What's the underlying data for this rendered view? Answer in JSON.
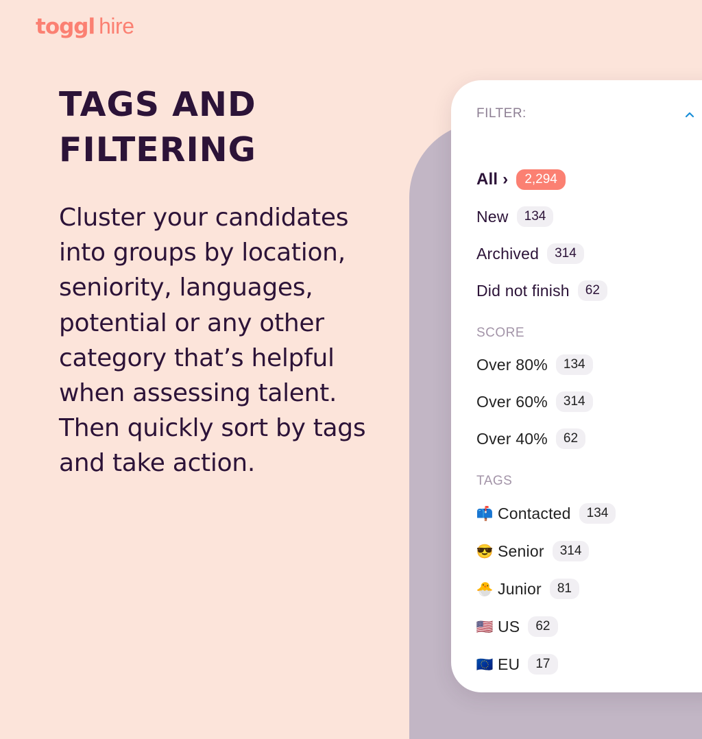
{
  "logo": {
    "brand": "toggl",
    "product": "hire"
  },
  "headline": "TAGS AND FILTERING",
  "description": "Cluster your candidates into groups by location, seniority, languages, potential or any other category that’s helpful when assessing talent. Then quickly sort by tags and take action.",
  "colors": {
    "accent": "#fb8072",
    "ink": "#2c1338",
    "background": "#fce4da",
    "backdrop": "#c2b6c5",
    "chevron": "#1a8fd8"
  },
  "filter": {
    "title": "FILTER:",
    "toggle_icon": "chevron-up-icon",
    "status": [
      {
        "label": "All ›",
        "count": "2,294",
        "active": true
      },
      {
        "label": "New",
        "count": "134"
      },
      {
        "label": "Archived",
        "count": "314"
      },
      {
        "label": "Did not finish",
        "count": "62"
      }
    ],
    "score_title": "SCORE",
    "score": [
      {
        "label": "Over 80%",
        "count": "134"
      },
      {
        "label": "Over 60%",
        "count": "314"
      },
      {
        "label": "Over 40%",
        "count": "62"
      }
    ],
    "tags_title": "TAGS",
    "tags": [
      {
        "emoji": "📫",
        "icon": "mailbox-icon",
        "label": "Contacted",
        "count": "134"
      },
      {
        "emoji": "😎",
        "icon": "sunglasses-face-icon",
        "label": "Senior",
        "count": "314"
      },
      {
        "emoji": "🐣",
        "icon": "hatching-chick-icon",
        "label": "Junior",
        "count": "81"
      },
      {
        "emoji": "🇺🇸",
        "icon": "us-flag-icon",
        "label": "US",
        "count": "62"
      },
      {
        "emoji": "🇪🇺",
        "icon": "eu-flag-icon",
        "label": "EU",
        "count": "17"
      }
    ]
  }
}
